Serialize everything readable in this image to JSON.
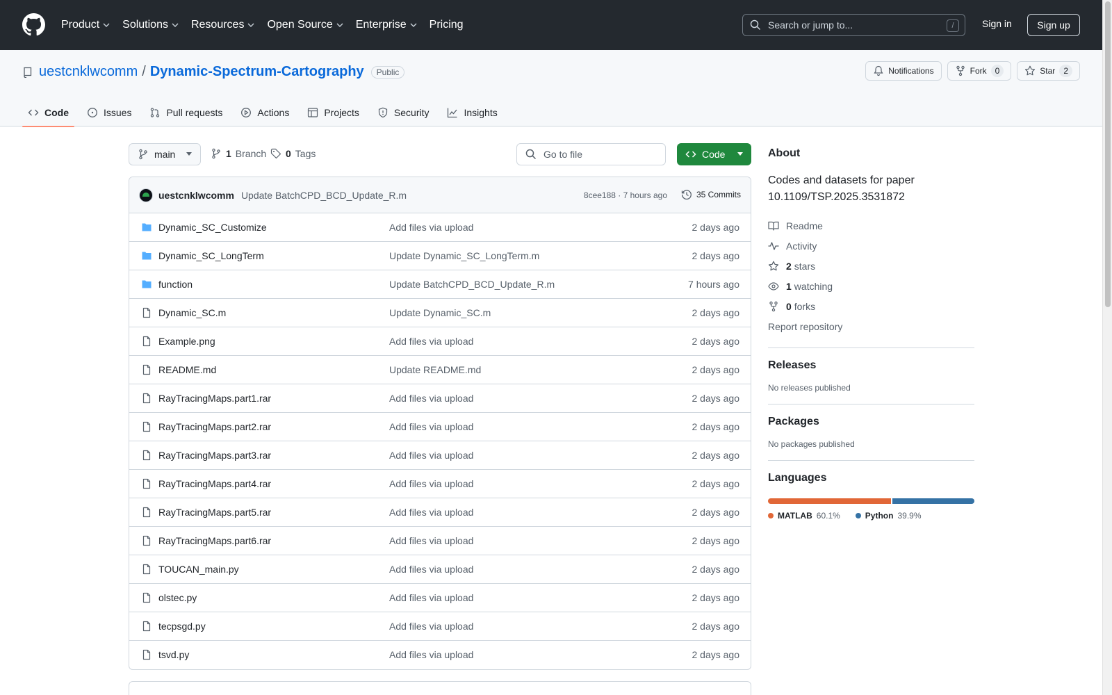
{
  "header": {
    "nav": [
      "Product",
      "Solutions",
      "Resources",
      "Open Source",
      "Enterprise",
      "Pricing"
    ],
    "search_placeholder": "Search or jump to...",
    "search_shortcut": "/",
    "sign_in": "Sign in",
    "sign_up": "Sign up"
  },
  "repo": {
    "owner": "uestcnklwcomm",
    "separator": "/",
    "name": "Dynamic-Spectrum-Cartography",
    "visibility": "Public",
    "notifications_label": "Notifications",
    "fork_label": "Fork",
    "fork_count": "0",
    "star_label": "Star",
    "star_count": "2",
    "tabs": [
      "Code",
      "Issues",
      "Pull requests",
      "Actions",
      "Projects",
      "Security",
      "Insights"
    ]
  },
  "toolbar": {
    "branch": "main",
    "branch_count": "1",
    "branch_label": "Branch",
    "tag_count": "0",
    "tag_label": "Tags",
    "go_to_file": "Go to file",
    "code_button": "Code"
  },
  "commit": {
    "user": "uestcnklwcomm",
    "message": "Update BatchCPD_BCD_Update_R.m",
    "meta": "8cee188 · 7 hours ago",
    "count": "35 Commits"
  },
  "files": [
    {
      "type": "dir",
      "name": "Dynamic_SC_Customize",
      "message": "Add files via upload",
      "date": "2 days ago"
    },
    {
      "type": "dir",
      "name": "Dynamic_SC_LongTerm",
      "message": "Update Dynamic_SC_LongTerm.m",
      "date": "2 days ago"
    },
    {
      "type": "dir",
      "name": "function",
      "message": "Update BatchCPD_BCD_Update_R.m",
      "date": "7 hours ago"
    },
    {
      "type": "file",
      "name": "Dynamic_SC.m",
      "message": "Update Dynamic_SC.m",
      "date": "2 days ago"
    },
    {
      "type": "file",
      "name": "Example.png",
      "message": "Add files via upload",
      "date": "2 days ago"
    },
    {
      "type": "file",
      "name": "README.md",
      "message": "Update README.md",
      "date": "2 days ago"
    },
    {
      "type": "file",
      "name": "RayTracingMaps.part1.rar",
      "message": "Add files via upload",
      "date": "2 days ago"
    },
    {
      "type": "file",
      "name": "RayTracingMaps.part2.rar",
      "message": "Add files via upload",
      "date": "2 days ago"
    },
    {
      "type": "file",
      "name": "RayTracingMaps.part3.rar",
      "message": "Add files via upload",
      "date": "2 days ago"
    },
    {
      "type": "file",
      "name": "RayTracingMaps.part4.rar",
      "message": "Add files via upload",
      "date": "2 days ago"
    },
    {
      "type": "file",
      "name": "RayTracingMaps.part5.rar",
      "message": "Add files via upload",
      "date": "2 days ago"
    },
    {
      "type": "file",
      "name": "RayTracingMaps.part6.rar",
      "message": "Add files via upload",
      "date": "2 days ago"
    },
    {
      "type": "file",
      "name": "TOUCAN_main.py",
      "message": "Add files via upload",
      "date": "2 days ago"
    },
    {
      "type": "file",
      "name": "olstec.py",
      "message": "Add files via upload",
      "date": "2 days ago"
    },
    {
      "type": "file",
      "name": "tecpsgd.py",
      "message": "Add files via upload",
      "date": "2 days ago"
    },
    {
      "type": "file",
      "name": "tsvd.py",
      "message": "Add files via upload",
      "date": "2 days ago"
    }
  ],
  "sidebar": {
    "about_title": "About",
    "description": "Codes and datasets for paper 10.1109/TSP.2025.3531872",
    "readme": "Readme",
    "activity": "Activity",
    "stars_count": "2",
    "stars_label": "stars",
    "watching_count": "1",
    "watching_label": "watching",
    "forks_count": "0",
    "forks_label": "forks",
    "report": "Report repository",
    "releases_title": "Releases",
    "releases_text": "No releases published",
    "packages_title": "Packages",
    "packages_text": "No packages published",
    "languages_title": "Languages",
    "languages": [
      {
        "name": "MATLAB",
        "percent": "60.1%",
        "value": 60.1,
        "color": "#e16737"
      },
      {
        "name": "Python",
        "percent": "39.9%",
        "value": 39.9,
        "color": "#3572a5"
      }
    ]
  },
  "colors": {
    "header_bg": "#24292f",
    "link": "#0969da",
    "primary_button": "#1f883d",
    "folder_icon": "#54aeff",
    "active_tab_underline": "#fd8c73"
  }
}
